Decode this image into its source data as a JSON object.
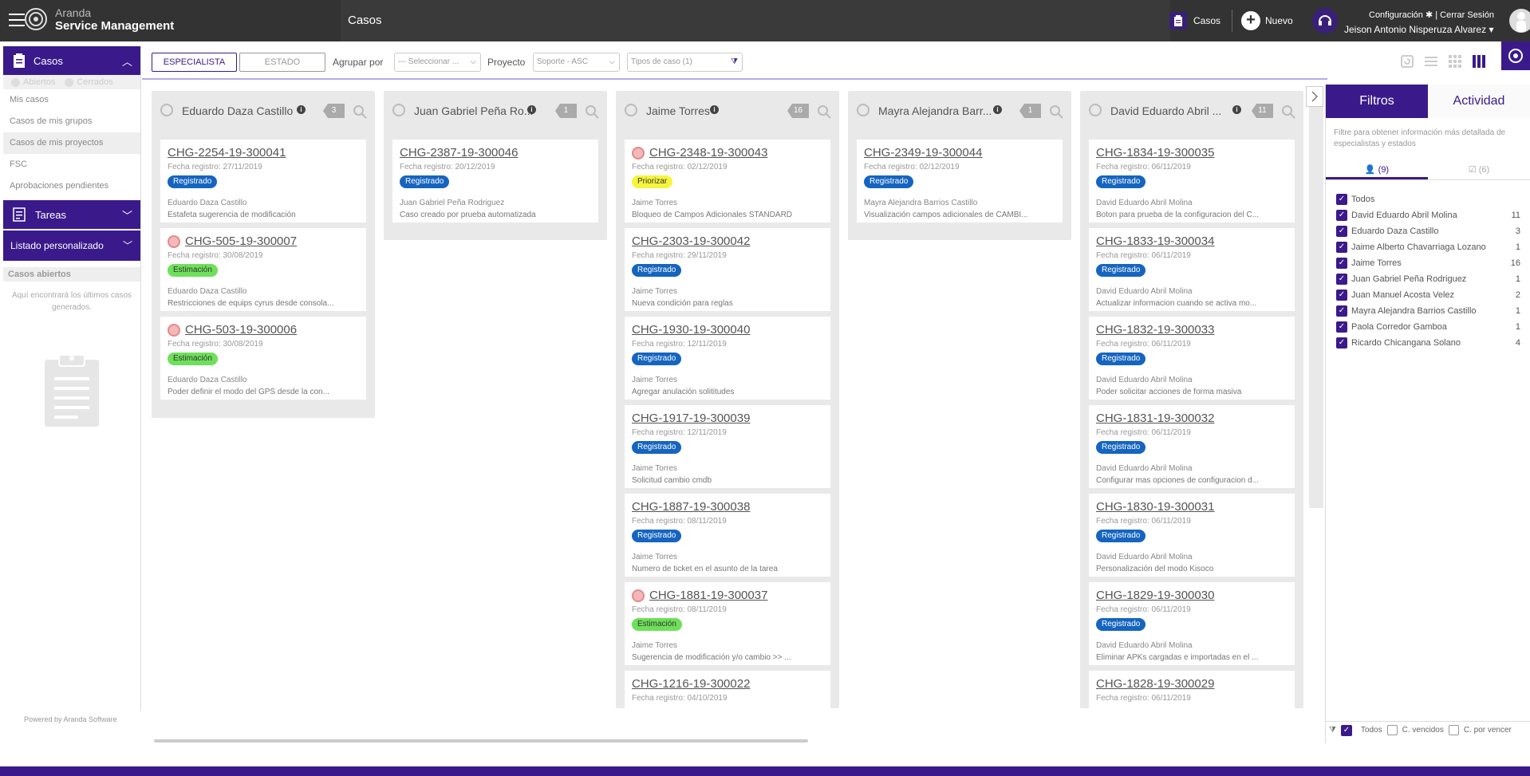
{
  "topbar": {
    "brand_line1": "Aranda",
    "brand_line2": "Service Management",
    "page_title": "Casos",
    "casos_label": "Casos",
    "nuevo_label": "Nuevo",
    "config_label": "Configuración",
    "logout_label": "| Cerrar Sesión",
    "user_name": "Jeison Antonio Nisperuza Alvarez"
  },
  "sidebar": {
    "casos_title": "Casos",
    "radio_abiertos": "Abiertos",
    "radio_cerrados": "Cerrados",
    "links": [
      "Mis casos",
      "Casos de mis grupos",
      "Casos de mis proyectos",
      "FSC",
      "Aprobaciones pendientes"
    ],
    "tareas_title": "Tareas",
    "listado_title": "Listado personalizado",
    "abiertos_title": "Casos abiertos",
    "abiertos_desc": "Aquí encontrará los últimos casos generados.",
    "powered": "Powered by Aranda Software"
  },
  "toolbar": {
    "especialista": "ESPECIALISTA",
    "estado": "ESTADO",
    "agrupar_label": "Agrupar por",
    "agrupar_value": "--- Seleccionar ...",
    "proyecto_label": "Proyecto",
    "proyecto_value": "Soporte - ASC",
    "tipos_value": "Tipos de caso (1)"
  },
  "columns": [
    {
      "name": "Eduardo Daza Castillo",
      "count": "3",
      "cards": [
        {
          "code": "CHG-2254-19-300041",
          "date": "Fecha registro: 27/11/2019",
          "status": "Registrado",
          "person": "Eduardo Daza Castillo",
          "desc": "Estafeta sugerencia de modificación"
        },
        {
          "code": "CHG-505-19-300007",
          "date": "Fecha registro: 30/08/2019",
          "status": "Estimación",
          "person": "Eduardo Daza Castillo",
          "desc": "Restricciones de equips cyrus desde consola..."
        },
        {
          "code": "CHG-503-19-300006",
          "date": "Fecha registro: 30/08/2019",
          "status": "Estimación",
          "person": "Eduardo Daza Castillo",
          "desc": "Poder definir el modo del GPS desde la con..."
        }
      ]
    },
    {
      "name": "Juan Gabriel Peña Ro...",
      "count": "1",
      "cards": [
        {
          "code": "CHG-2387-19-300046",
          "date": "Fecha registro: 20/12/2019",
          "status": "Registrado",
          "person": "Juan Gabriel Peña Rodriguez",
          "desc": "Caso creado por prueba automatizada"
        }
      ]
    },
    {
      "name": "Jaime Torres",
      "count": "16",
      "cards": [
        {
          "code": "CHG-2348-19-300043",
          "date": "Fecha registro: 02/12/2019",
          "status": "Priorizar",
          "person": "Jaime Torres",
          "desc": "Bloqueo de Campos Adicionales STANDARD"
        },
        {
          "code": "CHG-2303-19-300042",
          "date": "Fecha registro: 29/11/2019",
          "status": "Registrado",
          "person": "Jaime Torres",
          "desc": "Nueva condición para reglas"
        },
        {
          "code": "CHG-1930-19-300040",
          "date": "Fecha registro: 12/11/2019",
          "status": "Registrado",
          "person": "Jaime Torres",
          "desc": "Agregar anulación solititudes"
        },
        {
          "code": "CHG-1917-19-300039",
          "date": "Fecha registro: 12/11/2019",
          "status": "Registrado",
          "person": "Jaime Torres",
          "desc": "Solicitud cambio cmdb"
        },
        {
          "code": "CHG-1887-19-300038",
          "date": "Fecha registro: 08/11/2019",
          "status": "Registrado",
          "person": "Jaime Torres",
          "desc": "Numero de ticket en el asunto de la tarea"
        },
        {
          "code": "CHG-1881-19-300037",
          "date": "Fecha registro: 08/11/2019",
          "status": "Estimación",
          "person": "Jaime Torres",
          "desc": "Sugerencia de modificación y/o cambio >> ..."
        },
        {
          "code": "CHG-1216-19-300022",
          "date": "Fecha registro: 04/10/2019"
        }
      ]
    },
    {
      "name": "Mayra Alejandra Barr...",
      "count": "1",
      "cards": [
        {
          "code": "CHG-2349-19-300044",
          "date": "Fecha registro: 02/12/2019",
          "status": "Registrado",
          "person": "Mayra Alejandra Barrios Castillo",
          "desc": "Visualización campos adicionales de CAMBI..."
        }
      ]
    },
    {
      "name": "David Eduardo Abril ...",
      "count": "11",
      "cards": [
        {
          "code": "CHG-1834-19-300035",
          "date": "Fecha registro: 06/11/2019",
          "status": "Registrado",
          "person": "David Eduardo Abril Molina",
          "desc": "Boton para prueba de la configuracion del C..."
        },
        {
          "code": "CHG-1833-19-300034",
          "date": "Fecha registro: 06/11/2019",
          "status": "Registrado",
          "person": "David Eduardo Abril Molina",
          "desc": "Actualizar informacion cuando se activa mo..."
        },
        {
          "code": "CHG-1832-19-300033",
          "date": "Fecha registro: 06/11/2019",
          "status": "Registrado",
          "person": "David Eduardo Abril Molina",
          "desc": "Poder solicitar acciones de forma masiva"
        },
        {
          "code": "CHG-1831-19-300032",
          "date": "Fecha registro: 06/11/2019",
          "status": "Registrado",
          "person": "David Eduardo Abril Molina",
          "desc": "Configurar mas opciones de configuracion d..."
        },
        {
          "code": "CHG-1830-19-300031",
          "date": "Fecha registro: 06/11/2019",
          "status": "Registrado",
          "person": "David Eduardo Abril Molina",
          "desc": "Personalización del modo Kisoco"
        },
        {
          "code": "CHG-1829-19-300030",
          "date": "Fecha registro: 06/11/2019",
          "status": "Registrado",
          "person": "David Eduardo Abril Molina",
          "desc": "Eliminar APKs cargadas e importadas en el ..."
        },
        {
          "code": "CHG-1828-19-300029",
          "date": "Fecha registro: 06/11/2019"
        }
      ]
    }
  ],
  "rpanel": {
    "tab_filtros": "Filtros",
    "tab_actividad": "Actividad",
    "desc": "Filtre para obtener información más detallada de especialistas y estados",
    "people_tab": "(9)",
    "states_tab": "(6)",
    "filters": [
      {
        "label": "Todos",
        "n": ""
      },
      {
        "label": "David Eduardo Abril Molina",
        "n": "11"
      },
      {
        "label": "Eduardo Daza Castillo",
        "n": "3"
      },
      {
        "label": "Jaime Alberto Chavarriaga Lozano",
        "n": "1"
      },
      {
        "label": "Jaime Torres",
        "n": "16"
      },
      {
        "label": "Juan Gabriel Peña Rodriguez",
        "n": "1"
      },
      {
        "label": "Juan Manuel Acosta Velez",
        "n": "2"
      },
      {
        "label": "Mayra Alejandra Barrios Castillo",
        "n": "1"
      },
      {
        "label": "Paola Corredor Gamboa",
        "n": "1"
      },
      {
        "label": "Ricardo Chicangana Solano",
        "n": "4"
      }
    ],
    "foot_todos": "Todos",
    "foot_vencidos": "C. vencidos",
    "foot_porvencer": "C. por vencer"
  },
  "colors": {
    "accent": "#3a1a8a",
    "registrado": "#1565c0",
    "estimacion": "#6ee05a",
    "priorizar": "#f6f53c"
  }
}
